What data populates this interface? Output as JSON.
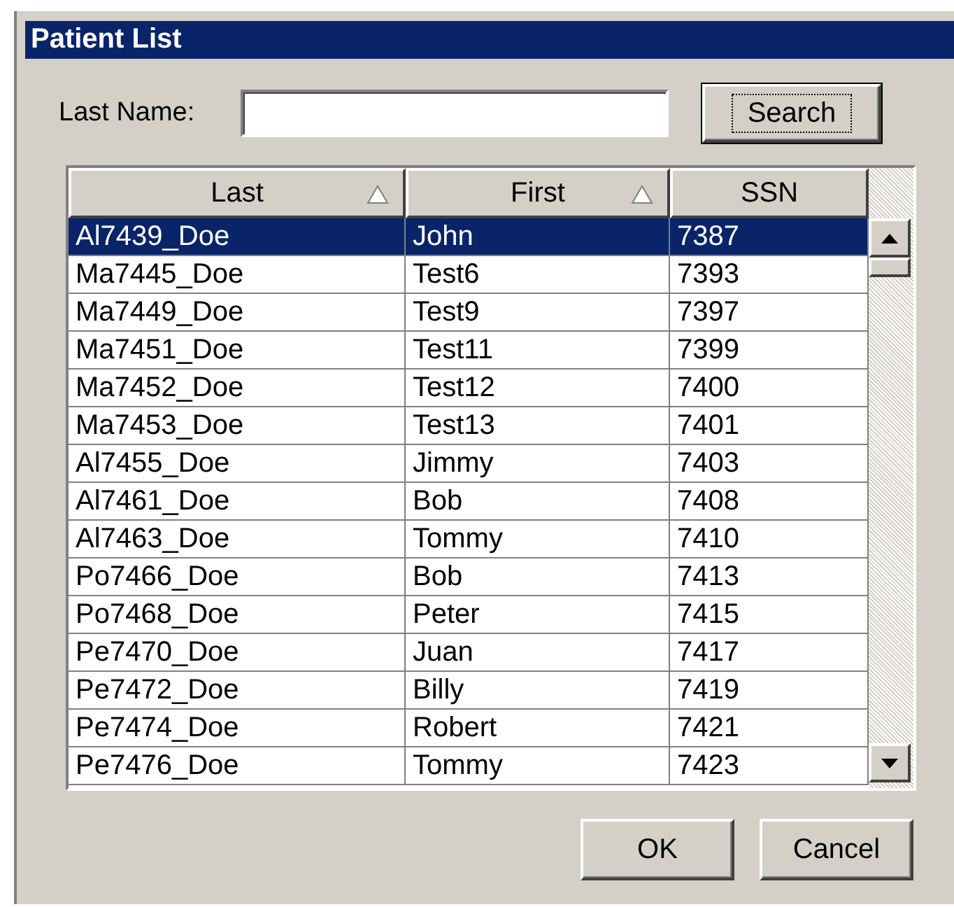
{
  "window": {
    "title": "Patient List"
  },
  "search": {
    "label": "Last Name:",
    "button": "Search"
  },
  "table": {
    "columns": [
      {
        "label": "Last",
        "sort_arrow": true
      },
      {
        "label": "First",
        "sort_arrow": true
      },
      {
        "label": "SSN",
        "sort_arrow": false
      }
    ],
    "rows": [
      {
        "cells": [
          "Al7439_Doe",
          "John",
          "7387"
        ],
        "selected": true
      },
      {
        "cells": [
          "Ma7445_Doe",
          "Test6",
          "7393"
        ],
        "selected": false
      },
      {
        "cells": [
          "Ma7449_Doe",
          "Test9",
          "7397"
        ],
        "selected": false
      },
      {
        "cells": [
          "Ma7451_Doe",
          "Test11",
          "7399"
        ],
        "selected": false
      },
      {
        "cells": [
          "Ma7452_Doe",
          "Test12",
          "7400"
        ],
        "selected": false
      },
      {
        "cells": [
          "Ma7453_Doe",
          "Test13",
          "7401"
        ],
        "selected": false
      },
      {
        "cells": [
          "Al7455_Doe",
          "Jimmy",
          "7403"
        ],
        "selected": false
      },
      {
        "cells": [
          "Al7461_Doe",
          "Bob",
          "7408"
        ],
        "selected": false
      },
      {
        "cells": [
          "Al7463_Doe",
          "Tommy",
          "7410"
        ],
        "selected": false
      },
      {
        "cells": [
          "Po7466_Doe",
          "Bob",
          "7413"
        ],
        "selected": false
      },
      {
        "cells": [
          "Po7468_Doe",
          "Peter",
          "7415"
        ],
        "selected": false
      },
      {
        "cells": [
          "Pe7470_Doe",
          "Juan",
          "7417"
        ],
        "selected": false
      },
      {
        "cells": [
          "Pe7472_Doe",
          "Billy",
          "7419"
        ],
        "selected": false
      },
      {
        "cells": [
          "Pe7474_Doe",
          "Robert",
          "7421"
        ],
        "selected": false
      },
      {
        "cells": [
          "Pe7476_Doe",
          "Tommy",
          "7423"
        ],
        "selected": false
      }
    ]
  },
  "buttons": [
    "OK",
    "Cancel"
  ]
}
